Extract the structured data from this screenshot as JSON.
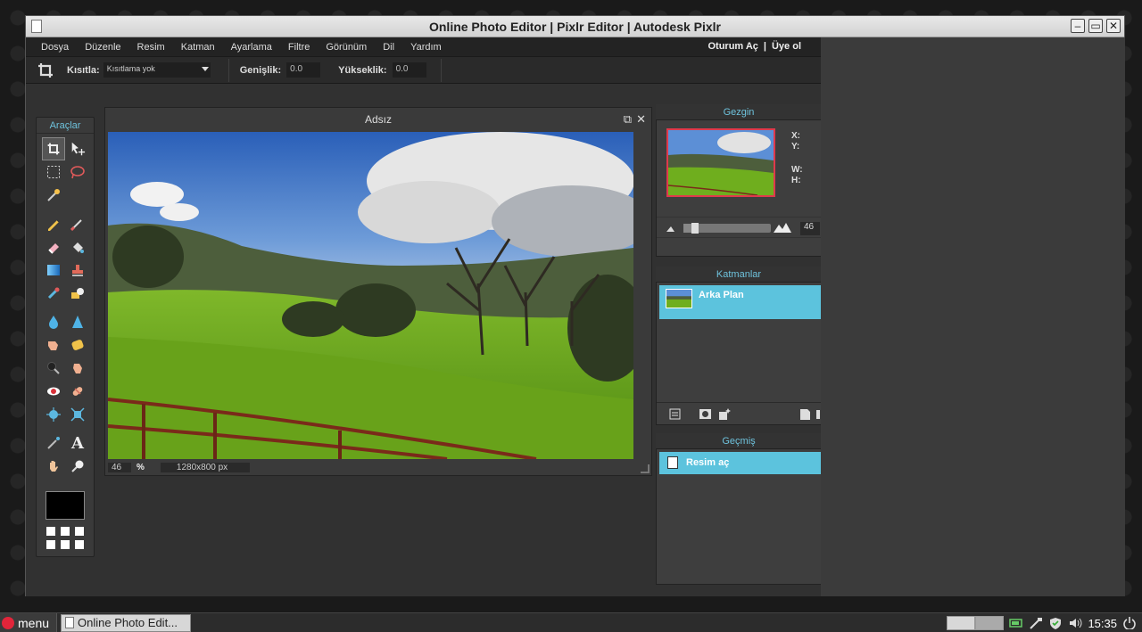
{
  "window": {
    "title": "Online Photo Editor | Pixlr Editor | Autodesk Pixlr"
  },
  "menubar": {
    "items": [
      "Dosya",
      "Düzenle",
      "Resim",
      "Katman",
      "Ayarlama",
      "Filtre",
      "Görünüm",
      "Dil",
      "Yardım"
    ],
    "login": "Oturum Aç",
    "separator": "|",
    "signup": "Üye ol"
  },
  "optionbar": {
    "constrain_label": "Kısıtla:",
    "constrain_value": "Kısıtlama yok",
    "width_label": "Genişlik:",
    "width_value": "0.0",
    "height_label": "Yükseklik:",
    "height_value": "0.0"
  },
  "toolbox": {
    "title": "Araçlar",
    "tools": [
      "crop-tool",
      "move-tool",
      "marquee-tool",
      "lasso-tool",
      "wand-tool",
      "pencil-tool",
      "brush-tool",
      "eraser-tool",
      "bucket-tool",
      "gradient-tool",
      "clone-tool",
      "color-replace-tool",
      "drawing-tool",
      "blur-tool",
      "sharpen-tool",
      "smudge-tool",
      "sponge-tool",
      "dodge-tool",
      "burn-tool",
      "red-eye-tool",
      "spot-heal-tool",
      "bloat-tool",
      "pinch-tool",
      "color-picker-tool",
      "type-tool",
      "hand-tool",
      "zoom-tool"
    ],
    "foreground_color": "#000000"
  },
  "document": {
    "title": "Adsız",
    "zoom": "46",
    "zoom_unit": "%",
    "dimensions": "1280x800 px"
  },
  "navigator": {
    "title": "Gezgin",
    "x_label": "X:",
    "y_label": "Y:",
    "w_label": "W:",
    "h_label": "H:",
    "zoom_value": "46",
    "zoom_fraction": 0.1
  },
  "layers": {
    "title": "Katmanlar",
    "items": [
      {
        "name": "Arka Plan",
        "selected": true
      }
    ]
  },
  "history": {
    "title": "Geçmiş",
    "items": [
      {
        "label": "Resim aç",
        "selected": true
      }
    ]
  },
  "taskbar": {
    "menu_label": "menu",
    "task_label": "Online Photo Edit...",
    "clock": "15:35"
  },
  "colors": {
    "accent": "#5cc3dd",
    "panel_title": "#6ec2dc",
    "nav_frame": "#e0394c"
  }
}
